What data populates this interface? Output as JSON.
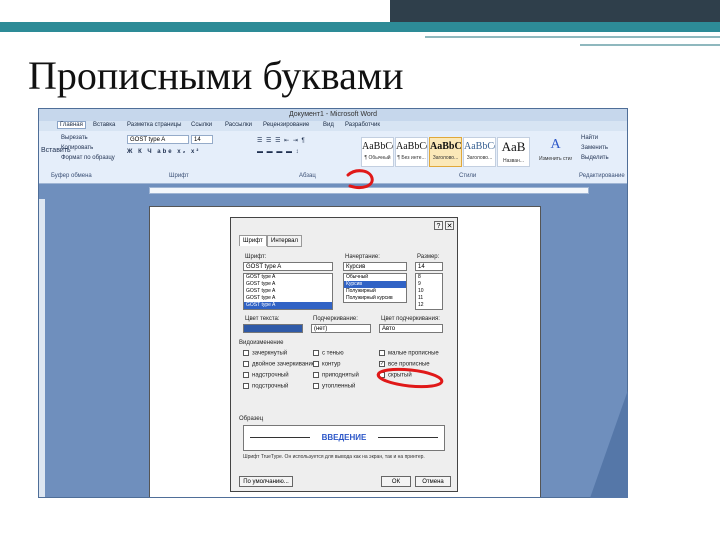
{
  "slide": {
    "title": "Прописными буквами"
  },
  "word": {
    "window_title": "Документ1 - Microsoft Word",
    "menu_tabs": [
      "Главная",
      "Вставка",
      "Разметка страницы",
      "Ссылки",
      "Рассылки",
      "Рецензирование",
      "Вид",
      "Разработчик"
    ],
    "ribbon": {
      "clipboard_items": [
        "Вырезать",
        "Копировать",
        "Формат по образцу"
      ],
      "paste_label": "Вставить",
      "font_name": "GOST type A",
      "font_size": "14",
      "group_labels": [
        "Буфер обмена",
        "Шрифт",
        "Абзац",
        "Стили",
        "Редактирование"
      ],
      "styles": [
        {
          "sample": "AaBbCc",
          "name": "¶ Обычный"
        },
        {
          "sample": "AaBbCc",
          "name": "¶ Без инте..."
        },
        {
          "sample": "AaBbCc",
          "name": "Заголово..."
        },
        {
          "sample": "AaBbCc",
          "name": "Заголово..."
        },
        {
          "sample": "AaB",
          "name": "Назван..."
        },
        {
          "sample": "A",
          "name": "Изменить стили"
        }
      ],
      "editing_items": [
        "Найти",
        "Заменить",
        "Выделить"
      ]
    }
  },
  "font_dialog": {
    "tabs": [
      "Шрифт",
      "Интервал"
    ],
    "help_symbol": "?",
    "close_symbol": "✕",
    "font_label": "Шрифт:",
    "font_value": "GOST type A",
    "font_list": [
      "GOST type A",
      "GOST type A",
      "GOST type A",
      "GOST type A",
      "GOST type A"
    ],
    "style_label": "Начертание:",
    "style_value": "Курсив",
    "style_list": [
      "Обычный",
      "Курсив",
      "Полужирный",
      "Полужирный курсив"
    ],
    "size_label": "Размер:",
    "size_value": "14",
    "size_list": [
      "8",
      "9",
      "10",
      "11",
      "12"
    ],
    "text_color_label": "Цвет текста:",
    "underline_label": "Подчеркивание:",
    "underline_value": "(нет)",
    "underline_color_label": "Цвет подчеркивания:",
    "underline_color_value": "Авто",
    "effects_label": "Видоизменение",
    "effects": [
      {
        "label": "зачеркнутый",
        "checked": false
      },
      {
        "label": "двойное зачеркивание",
        "checked": false
      },
      {
        "label": "надстрочный",
        "checked": false
      },
      {
        "label": "подстрочный",
        "checked": false
      },
      {
        "label": "с тенью",
        "checked": false
      },
      {
        "label": "контур",
        "checked": false
      },
      {
        "label": "приподнятый",
        "checked": false
      },
      {
        "label": "утопленный",
        "checked": false
      },
      {
        "label": "малые прописные",
        "checked": false
      },
      {
        "label": "все прописные",
        "checked": true
      },
      {
        "label": "скрытый",
        "checked": false
      }
    ],
    "sample_label": "Образец",
    "preview_text": "ВВЕДЕНИЕ",
    "preview_note": "Шрифт TrueType. Он используется для вывода как на экран, так и на принтер.",
    "default_button": "По умолчанию...",
    "ok_button": "ОК",
    "cancel_button": "Отмена"
  },
  "colors": {
    "teal_band": "#2d8b97",
    "dark_band": "#2f3f4b",
    "annotation_red": "#e01818",
    "preview_blue": "#2b56c8"
  }
}
